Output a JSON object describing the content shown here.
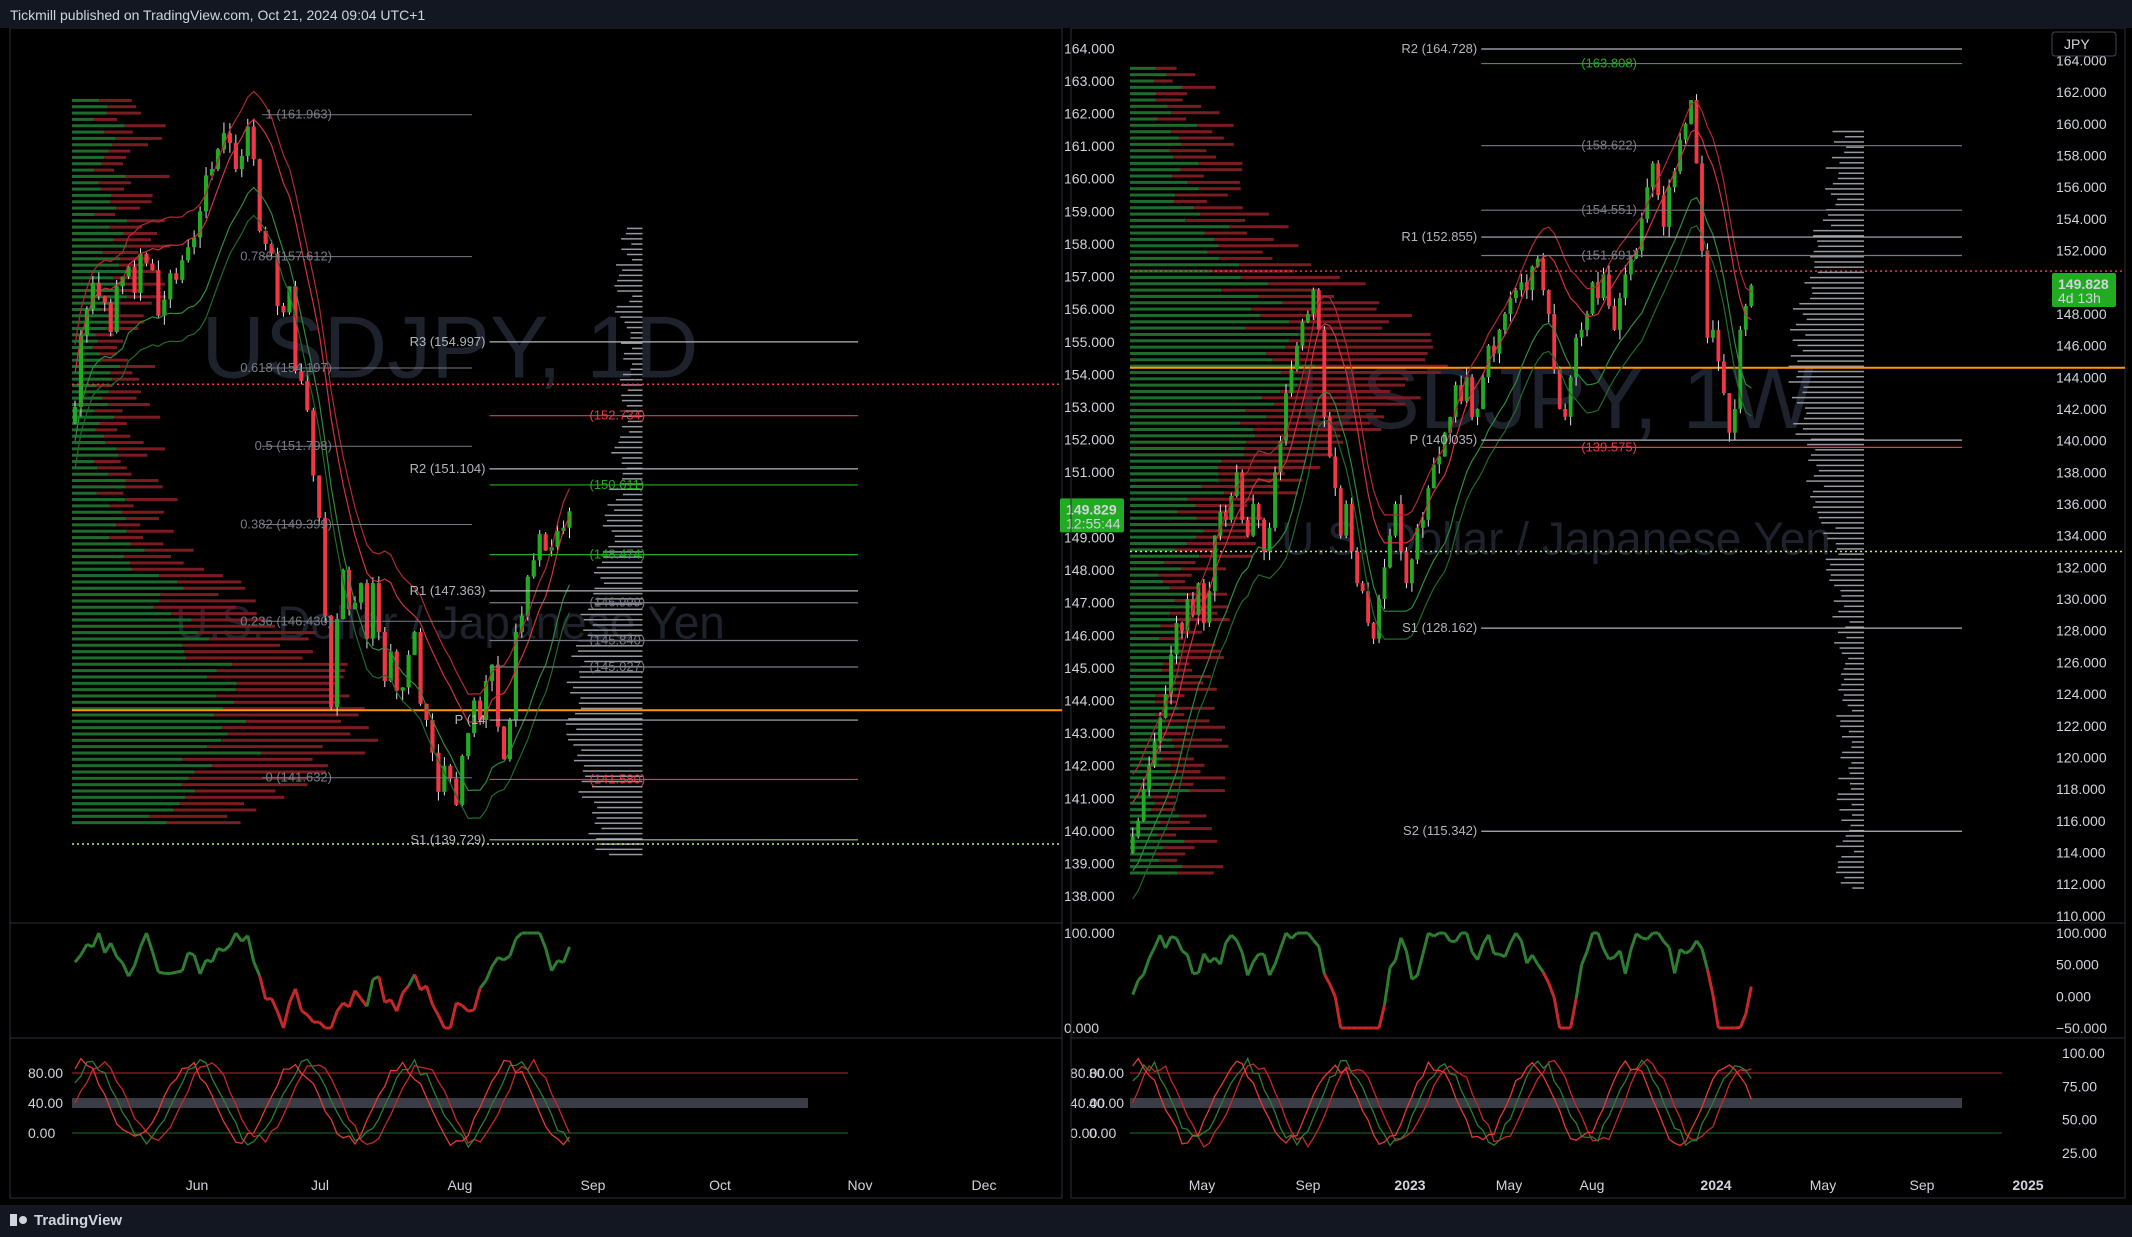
{
  "header": {
    "published": "Tickmill published on TradingView.com, Oct 21, 2024 09:04 UTC+1"
  },
  "footer": {
    "brand": "TradingView"
  },
  "colors": {
    "up": "#22ab22",
    "down": "#f23645",
    "vwap": "#ff9800",
    "bg": "#000000",
    "panel": "#131722",
    "grid": "#2a2e39",
    "text": "#d1d4dc"
  },
  "chart_data": [
    {
      "type": "candlestick",
      "symbol": "USDJPY, 1D",
      "description": "U.S. Dollar / Japanese Yen",
      "x_ticks": [
        "Jun",
        "Jul",
        "Aug",
        "Sep",
        "Oct",
        "Nov",
        "Dec"
      ],
      "price_axis": [
        "164.000",
        "163.000",
        "162.000",
        "161.000",
        "160.000",
        "159.000",
        "158.000",
        "157.000",
        "156.000",
        "155.000",
        "154.000",
        "153.000",
        "152.000",
        "151.000",
        "150.000",
        "149.000",
        "148.000",
        "147.000",
        "146.000",
        "145.000",
        "144.000",
        "143.000",
        "142.000",
        "141.000",
        "140.000",
        "139.000",
        "138.000"
      ],
      "ylim": [
        137.3,
        164.5
      ],
      "last_price": {
        "value": "149.829",
        "countdown": "12:55:44"
      },
      "closes": [
        153.0,
        155.2,
        156.0,
        156.8,
        156.4,
        156.2,
        155.3,
        156.7,
        157.0,
        157.3,
        156.5,
        157.7,
        157.4,
        157.2,
        155.8,
        156.3,
        157.1,
        156.9,
        157.5,
        157.9,
        158.2,
        159.0,
        160.1,
        160.3,
        160.9,
        161.4,
        161.1,
        160.3,
        160.7,
        161.6,
        160.6,
        158.4,
        158.0,
        157.7,
        156.1,
        155.9,
        156.7,
        154.1,
        153.8,
        152.9,
        150.9,
        149.6,
        146.6,
        143.8,
        146.5,
        148.0,
        146.8,
        147.0,
        147.6,
        145.9,
        147.6,
        146.1,
        144.6,
        145.5,
        144.3,
        144.4,
        145.4,
        146.1,
        143.9,
        143.4,
        142.4,
        141.2,
        142.0,
        141.6,
        140.8,
        142.3,
        143.0,
        144.0,
        143.4,
        144.6,
        145.1,
        143.2,
        142.2,
        143.4,
        146.1,
        146.6,
        147.8,
        148.3,
        149.1,
        148.6,
        148.7,
        149.2,
        149.3,
        149.8
      ],
      "levels": [
        {
          "label": "R3 (154.997)",
          "value": 154.997,
          "color": "#b2b5be"
        },
        {
          "label": "(152.734)",
          "value": 152.734,
          "color": "#f23645"
        },
        {
          "label": "R2 (151.104)",
          "value": 151.104,
          "color": "#b2b5be"
        },
        {
          "label": "(150.611)",
          "value": 150.611,
          "color": "#22ab22"
        },
        {
          "label": "(148.474)",
          "value": 148.474,
          "color": "#22ab22"
        },
        {
          "label": "R1 (147.363)",
          "value": 147.363,
          "color": "#b2b5be"
        },
        {
          "label": "(146.999)",
          "value": 146.999,
          "color": "#787b86"
        },
        {
          "label": "(145.840)",
          "value": 145.84,
          "color": "#787b86"
        },
        {
          "label": "(145.027)",
          "value": 145.027,
          "color": "#787b86"
        },
        {
          "label": "P (14",
          "value": 143.4,
          "color": "#b2b5be"
        },
        {
          "label": "(141.580)",
          "value": 141.58,
          "color": "#f23645"
        },
        {
          "label": "S1 (139.729)",
          "value": 139.729,
          "color": "#b2b5be"
        }
      ],
      "fib": [
        {
          "label": "1 (161.963)",
          "value": 161.963
        },
        {
          "label": "0.786 (157.612)",
          "value": 157.612
        },
        {
          "label": "0.618 (154.197)",
          "value": 154.197
        },
        {
          "label": "0.5 (151.798)",
          "value": 151.798
        },
        {
          "label": "0.382 (149.399)",
          "value": 149.399
        },
        {
          "label": "0.236 (146.430)",
          "value": 146.43
        },
        {
          "label": "0 (141.632)",
          "value": 141.632
        }
      ],
      "hlines": {
        "orange": 143.7,
        "red_dotted": 153.7,
        "green_dotted": 139.6
      },
      "osc1_axis": [
        "100.000",
        "0.000"
      ],
      "osc2_axis": [
        "80.00",
        "40.00",
        "0.00"
      ]
    },
    {
      "type": "candlestick",
      "symbol": "USDJPY, 1W",
      "description": "U.S. Dollar / Japanese Yen",
      "currency": "JPY",
      "x_ticks": [
        "May",
        "Sep",
        "2023",
        "May",
        "Aug",
        "2024",
        "May",
        "Sep",
        "2025"
      ],
      "price_axis": [
        "164.000",
        "162.000",
        "160.000",
        "158.000",
        "156.000",
        "154.000",
        "152.000",
        "150.000",
        "148.000",
        "146.000",
        "144.000",
        "142.000",
        "140.000",
        "138.000",
        "136.000",
        "134.000",
        "132.000",
        "130.000",
        "128.000",
        "126.000",
        "124.000",
        "122.000",
        "120.000",
        "118.000",
        "116.000",
        "114.000",
        "112.000",
        "110.000"
      ],
      "ylim": [
        109.8,
        165.8
      ],
      "last_price": {
        "value": "149.828",
        "countdown": "4d 13h"
      },
      "closes": [
        115.0,
        116.0,
        118.0,
        119.5,
        121.0,
        122.5,
        124.0,
        126.5,
        128.5,
        128.0,
        130.0,
        129.0,
        131.0,
        128.5,
        130.5,
        134.0,
        135.5,
        135.0,
        136.5,
        138.0,
        135.0,
        134.0,
        136.0,
        135.0,
        133.0,
        134.5,
        138.0,
        140.0,
        143.0,
        144.5,
        146.0,
        147.5,
        148.0,
        149.5,
        147.0,
        141.5,
        139.0,
        137.0,
        134.0,
        136.0,
        133.0,
        131.0,
        130.5,
        128.5,
        127.5,
        130.0,
        132.0,
        134.0,
        136.0,
        133.0,
        131.0,
        132.5,
        134.5,
        135.0,
        137.0,
        138.5,
        139.0,
        140.5,
        141.5,
        143.5,
        142.5,
        144.0,
        141.5,
        142.0,
        144.0,
        146.0,
        145.5,
        147.0,
        148.0,
        149.0,
        149.5,
        150.0,
        149.5,
        151.0,
        151.5,
        149.5,
        148.0,
        144.5,
        142.0,
        141.5,
        144.0,
        146.5,
        147.0,
        148.0,
        150.0,
        149.0,
        150.5,
        148.5,
        147.0,
        149.0,
        150.5,
        151.5,
        152.0,
        154.0,
        156.0,
        157.5,
        155.5,
        153.5,
        156.0,
        157.0,
        159.0,
        160.0,
        161.5,
        157.5,
        152.0,
        146.5,
        147.0,
        145.0,
        143.0,
        140.5,
        142.0,
        147.0,
        148.5,
        149.8
      ],
      "levels": [
        {
          "label": "R2 (164.728)",
          "value": 164.728,
          "color": "#b2b5be"
        },
        {
          "label": "(163.808)",
          "value": 163.808,
          "color": "#22ab22"
        },
        {
          "label": "(158.622)",
          "value": 158.622,
          "color": "#787b86"
        },
        {
          "label": "(154.551)",
          "value": 154.551,
          "color": "#787b86"
        },
        {
          "label": "R1 (152.855)",
          "value": 152.855,
          "color": "#b2b5be"
        },
        {
          "label": "(151.691)",
          "value": 151.691,
          "color": "#787b86"
        },
        {
          "label": "P (140.035)",
          "value": 140.035,
          "color": "#b2b5be"
        },
        {
          "label": "(139.575)",
          "value": 139.575,
          "color": "#f23645"
        },
        {
          "label": "S1 (128.162)",
          "value": 128.162,
          "color": "#b2b5be"
        },
        {
          "label": "S2 (115.342)",
          "value": 115.342,
          "color": "#b2b5be"
        }
      ],
      "hlines": {
        "orange": 144.6,
        "red_dotted": 150.7,
        "green_dotted": 133.0
      },
      "osc1_axis": [
        "100.000",
        "50.000",
        "0.000",
        "−50.000"
      ],
      "osc2_axis_left": [
        "80.00",
        "40.00",
        "0.00"
      ],
      "osc2_axis_right": [
        "100.00",
        "75.00",
        "50.00",
        "25.00"
      ]
    }
  ]
}
